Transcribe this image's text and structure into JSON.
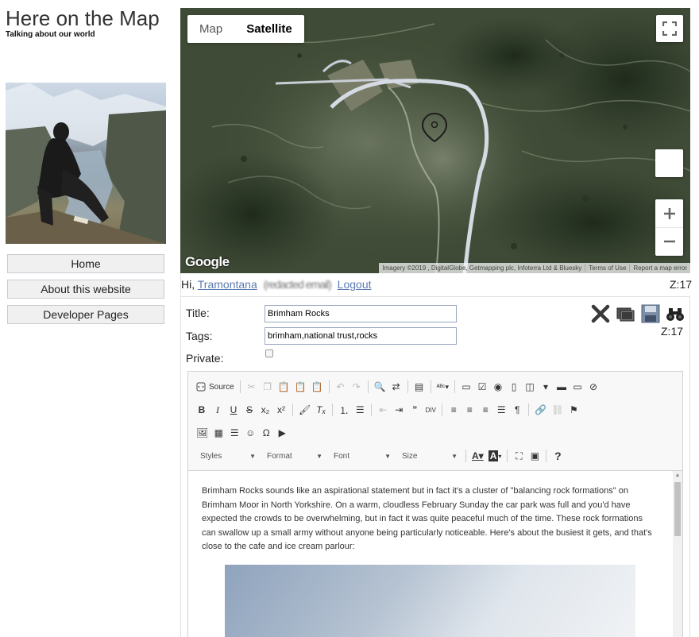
{
  "site": {
    "title": "Here on the Map",
    "tagline": "Talking about our world"
  },
  "nav": {
    "items": [
      {
        "label": "Home"
      },
      {
        "label": "About this website"
      },
      {
        "label": "Developer Pages"
      }
    ]
  },
  "map": {
    "type_buttons": {
      "map": "Map",
      "satellite": "Satellite"
    },
    "google": "Google",
    "attribution": {
      "imagery": "Imagery ©2019 , DigitalGlobe, Getmapping plc, Infoterra Ltd & Bluesky",
      "terms": "Terms of Use",
      "report": "Report a map error"
    }
  },
  "user": {
    "greeting": "Hi,",
    "name": "Tramontana",
    "email_redacted": "(redacted email)",
    "logout": "Logout",
    "zoom": "Z:17"
  },
  "form": {
    "title_label": "Title:",
    "title_value": "Brimham Rocks",
    "tags_label": "Tags:",
    "tags_value": "brimham,national trust,rocks",
    "private_label": "Private:",
    "zoom": "Z:17"
  },
  "editor": {
    "source_label": "Source",
    "combos": {
      "styles": "Styles",
      "format": "Format",
      "font": "Font",
      "size": "Size"
    },
    "content": "Brimham Rocks sounds like an aspirational statement but in fact it's a cluster of \"balancing rock formations\" on Brimham Moor in North Yorkshire. On a warm, cloudless February Sunday the car park was full and you'd have expected the crowds to be overwhelming, but in fact it was quite peaceful much of the time. These rock formations can swallow up a small army without anyone being particularly noticeable. Here's about the busiest it gets, and that's close to the cafe and ice cream parlour:"
  }
}
